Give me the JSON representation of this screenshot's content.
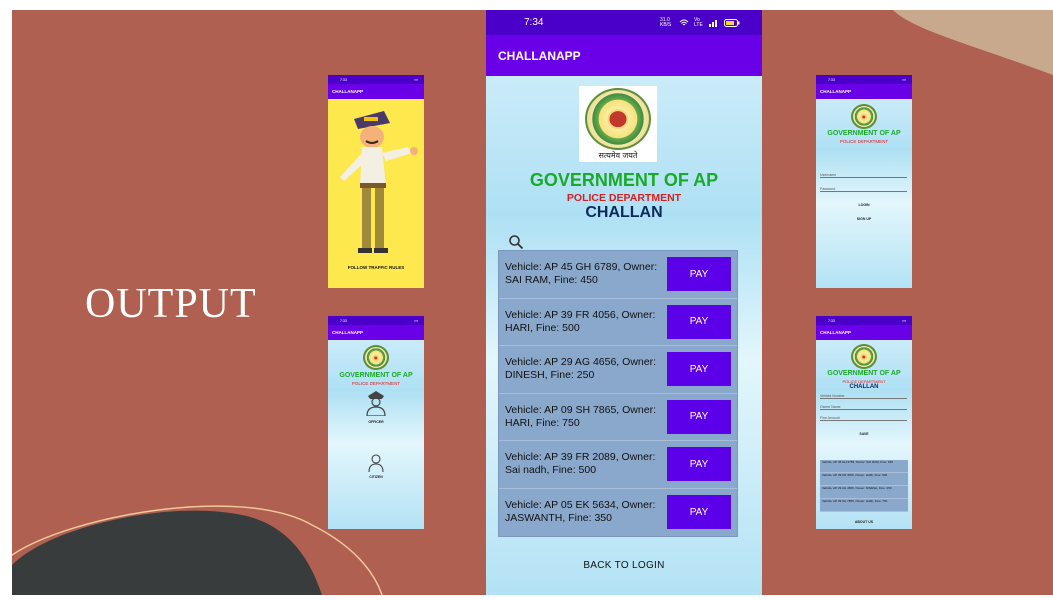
{
  "slide": {
    "heading": "OUTPUT"
  },
  "main_phone": {
    "status": {
      "time": "7:34",
      "speed": "31.0 KB/S",
      "signal": "Vo LTE",
      "battery_level": 0.7
    },
    "app_title": "CHALLANAPP",
    "seal_caption": "सत्यमेव जयते",
    "gov_title": "GOVERNMENT OF AP",
    "police_title": "POLICE DEPARTMENT",
    "challan_title": "CHALLAN",
    "search_icon": "search-icon",
    "challans": [
      {
        "text": "Vehicle: AP 45 GH 6789, Owner: SAI RAM, Fine: 450",
        "action": "PAY"
      },
      {
        "text": "Vehicle: AP 39 FR 4056, Owner: HARI, Fine: 500",
        "action": "PAY"
      },
      {
        "text": "Vehicle: AP 29 AG 4656, Owner: DINESH, Fine: 250",
        "action": "PAY"
      },
      {
        "text": "Vehicle: AP 09 SH 7865, Owner: HARI, Fine: 750",
        "action": "PAY"
      },
      {
        "text": "Vehicle: AP 39 FR 2089, Owner: Sai nadh, Fine: 500",
        "action": "PAY"
      },
      {
        "text": "Vehicle: AP 05 EK 5634, Owner: JASWANTH, Fine: 350",
        "action": "PAY"
      }
    ],
    "back_label": "BACK TO LOGIN"
  },
  "splash_phone": {
    "app_title": "CHALLANAPP",
    "caption": "FOLLOW TRAFFIC RULES"
  },
  "role_phone": {
    "app_title": "CHALLANAPP",
    "gov_title": "GOVERNMENT OF AP",
    "police_title": "POLICE DEPARTMENT",
    "officer_label": "OFFICER",
    "citizen_label": "CITIZEN"
  },
  "login_phone": {
    "app_title": "CHALLANAPP",
    "gov_title": "GOVERNMENT OF AP",
    "police_title": "POLICE DEPARTMENT",
    "username_placeholder": "Username",
    "password_placeholder": "Password",
    "login_label": "LOGIN",
    "signup_label": "SIGN UP"
  },
  "officer_phone": {
    "app_title": "CHALLANAPP",
    "gov_title": "GOVERNMENT OF AP",
    "police_title": "POLICE DEPARTMENT",
    "challan_title": "CHALLAN",
    "vehicle_placeholder": "Vehicle Number",
    "owner_placeholder": "Owner Name",
    "fine_placeholder": "Fine Amount",
    "save_label": "SAVE",
    "entries": [
      "Vehicle: AP 45 GH 6789, Owner: SAI RAM, Fine: 450",
      "Vehicle: AP 39 FR 4056, Owner: HARI, Fine: 500",
      "Vehicle: AP 29 AG 4656, Owner: DINESH, Fine: 250",
      "Vehicle: AP 09 SH 7865, Owner: HARI, Fine: 750"
    ],
    "about_label": "ABOUT US"
  },
  "colors": {
    "slide_bg": "#b06050",
    "status_bar": "#4a00c8",
    "app_bar": "#6a00e8",
    "pay_button": "#5b00e8",
    "gov_green": "#1aaa2a",
    "police_red": "#d81e1e",
    "list_bg": "#8aa7cc"
  }
}
